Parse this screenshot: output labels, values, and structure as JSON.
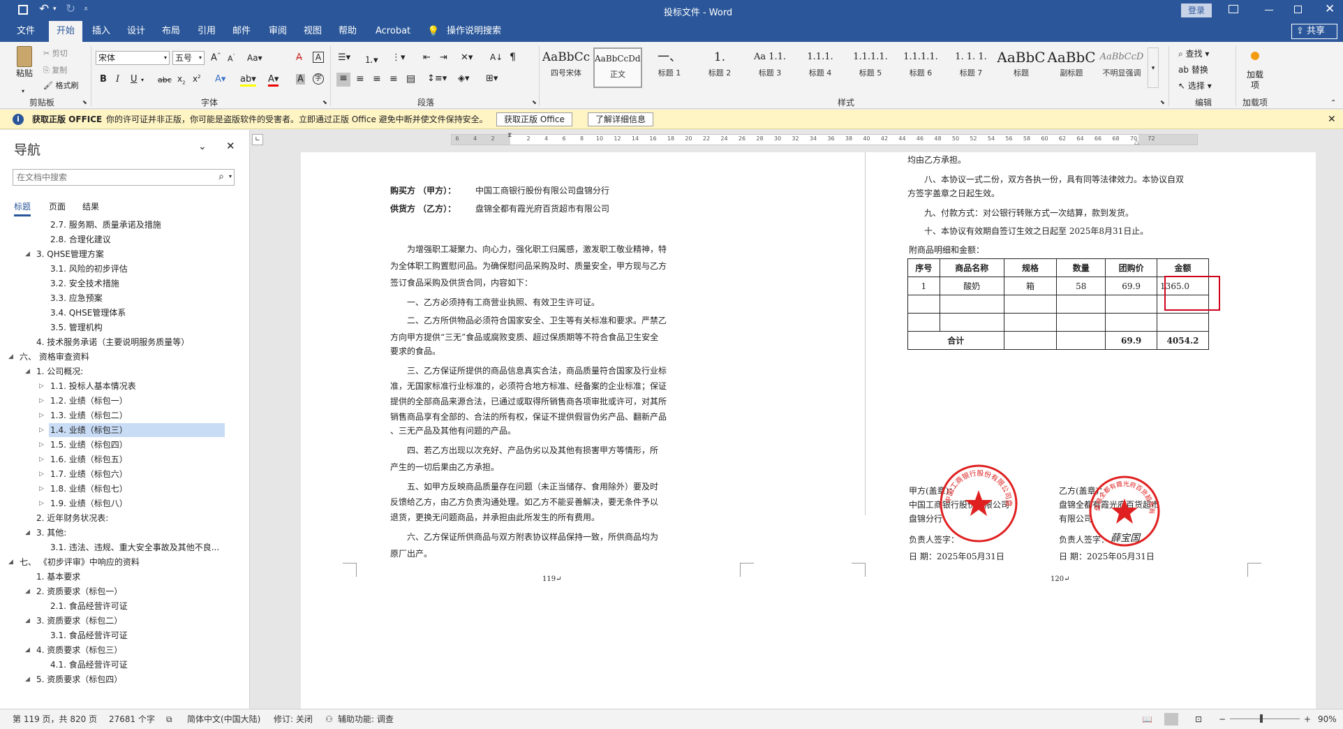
{
  "titlebar": {
    "title": "投标文件  -  Word",
    "login": "登录"
  },
  "menu": {
    "items": [
      "文件",
      "开始",
      "插入",
      "设计",
      "布局",
      "引用",
      "邮件",
      "审阅",
      "视图",
      "帮助",
      "Acrobat",
      "操作说明搜索"
    ],
    "share": "共享"
  },
  "ribbon": {
    "clipboard": {
      "paste": "粘贴",
      "cut": "剪切",
      "copy": "复制",
      "format_painter": "格式刷",
      "label": "剪贴板"
    },
    "font": {
      "font_name": "宋体",
      "font_size": "五号",
      "label": "字体"
    },
    "paragraph": {
      "label": "段落"
    },
    "styles": {
      "label": "样式",
      "items": [
        {
          "sample": "AaBbCc",
          "name": "四号宋体"
        },
        {
          "sample": "AaBbCcDdE",
          "name": "正文"
        },
        {
          "sample": "一、",
          "name": "标题 1"
        },
        {
          "sample": "1.",
          "name": "标题 2"
        },
        {
          "sample": "Aa 1.1.",
          "name": "标题 3"
        },
        {
          "sample": "1.1.1.",
          "name": "标题 4"
        },
        {
          "sample": "1.1.1.1.",
          "name": "标题 5"
        },
        {
          "sample": "1.1.1.1.",
          "name": "标题 6"
        },
        {
          "sample": "1. 1. 1.",
          "name": "标题 7"
        },
        {
          "sample": "AaBbC",
          "name": "标题"
        },
        {
          "sample": "AaBbC",
          "name": "副标题"
        },
        {
          "sample": "AaBbCcD",
          "name": "不明显强调"
        }
      ]
    },
    "editing": {
      "find": "查找",
      "replace": "替换",
      "select": "选择",
      "label": "编辑"
    },
    "addins": {
      "add": "加载项",
      "label": "加载项"
    }
  },
  "infobar": {
    "title": "获取正版 OFFICE",
    "message": "你的许可证并非正版，你可能是盗版软件的受害者。立即通过正版 Office 避免中断并使文件保持安全。",
    "btn_get": "获取正版 Office",
    "btn_learn": "了解详细信息"
  },
  "nav": {
    "title": "导航",
    "search_placeholder": "在文档中搜索",
    "tabs": [
      "标题",
      "页面",
      "结果"
    ],
    "items": [
      {
        "text": "2.7. 服务期、质量承诺及措施",
        "level": 3,
        "arrow": ""
      },
      {
        "text": "2.8. 合理化建议",
        "level": 3,
        "arrow": ""
      },
      {
        "text": "3. QHSE管理方案",
        "level": 2,
        "arrow": "open"
      },
      {
        "text": "3.1. 风险的初步评估",
        "level": 3,
        "arrow": ""
      },
      {
        "text": "3.2. 安全技术措施",
        "level": 3,
        "arrow": ""
      },
      {
        "text": "3.3. 应急预案",
        "level": 3,
        "arrow": ""
      },
      {
        "text": "3.4. QHSE管理体系",
        "level": 3,
        "arrow": ""
      },
      {
        "text": "3.5. 管理机构",
        "level": 3,
        "arrow": ""
      },
      {
        "text": "4. 技术服务承诺（主要说明服务质量等）",
        "level": 2,
        "arrow": ""
      },
      {
        "text": "六、 资格审查资料",
        "level": 1,
        "arrow": "open"
      },
      {
        "text": "1. 公司概况:",
        "level": 2,
        "arrow": "open"
      },
      {
        "text": "1.1. 投标人基本情况表",
        "level": 3,
        "arrow": "closed"
      },
      {
        "text": "1.2. 业绩（标包一）",
        "level": 3,
        "arrow": "closed"
      },
      {
        "text": "1.3. 业绩（标包二）",
        "level": 3,
        "arrow": "closed"
      },
      {
        "text": "1.4. 业绩（标包三）",
        "level": 3,
        "arrow": "closed",
        "selected": true
      },
      {
        "text": "1.5. 业绩（标包四）",
        "level": 3,
        "arrow": "closed"
      },
      {
        "text": "1.6. 业绩（标包五）",
        "level": 3,
        "arrow": "closed"
      },
      {
        "text": "1.7. 业绩（标包六）",
        "level": 3,
        "arrow": "closed"
      },
      {
        "text": "1.8. 业绩（标包七）",
        "level": 3,
        "arrow": "closed"
      },
      {
        "text": "1.9. 业绩（标包八）",
        "level": 3,
        "arrow": "closed"
      },
      {
        "text": "2. 近年财务状况表:",
        "level": 2,
        "arrow": ""
      },
      {
        "text": "3. 其他:",
        "level": 2,
        "arrow": "open"
      },
      {
        "text": "3.1. 违法、违规、重大安全事故及其他不良...",
        "level": 3,
        "arrow": ""
      },
      {
        "text": "七、 《初步评审》中响应的资料",
        "level": 1,
        "arrow": "open"
      },
      {
        "text": "1. 基本要求",
        "level": 2,
        "arrow": ""
      },
      {
        "text": "2. 资质要求（标包一）",
        "level": 2,
        "arrow": "open"
      },
      {
        "text": "2.1. 食品经营许可证",
        "level": 3,
        "arrow": ""
      },
      {
        "text": "3. 资质要求（标包二）",
        "level": 2,
        "arrow": "open"
      },
      {
        "text": "3.1. 食品经营许可证",
        "level": 3,
        "arrow": ""
      },
      {
        "text": "4. 资质要求（标包三）",
        "level": 2,
        "arrow": "open"
      },
      {
        "text": "4.1. 食品经营许可证",
        "level": 3,
        "arrow": ""
      },
      {
        "text": "5. 资质要求（标包四）",
        "level": 2,
        "arrow": "open"
      }
    ]
  },
  "ruler": {
    "ticks": [
      "6",
      "4",
      "2",
      "",
      "2",
      "4",
      "6",
      "8",
      "10",
      "12",
      "14",
      "16",
      "18",
      "20",
      "22",
      "24",
      "26",
      "28",
      "30",
      "32",
      "34",
      "36",
      "38",
      "40",
      "42",
      "44",
      "46",
      "48",
      "50",
      "52",
      "54",
      "56",
      "58",
      "60",
      "62",
      "64",
      "66",
      "68",
      "70",
      "72"
    ]
  },
  "page_left": {
    "buyer": "购买方 （甲方）：",
    "buyer_name": "中国工商银行股份有限公司盘锦分行",
    "seller": "供货方 （乙方）：",
    "seller_name": "盘锦全都有霞光府百货超市有限公司",
    "lines": [
      "　　为增强职工凝聚力、向心力，强化职工归属感，激发职工敬业精神，特",
      "为全体职工购置慰问品。为确保慰问品采购及时、质量安全，甲方现与乙方",
      "签订食品采购及供货合同，内容如下：",
      "　　一、乙方必须持有工商营业执照、有效卫生许可证。",
      "　　二、乙方所供物品必须符合国家安全、卫生等有关标准和要求。严禁乙",
      "方向甲方提供“三无”食品或腐败变质、超过保质期等不符合食品卫生安全",
      "要求的食品。",
      "　　三、乙方保证所提供的商品信息真实合法，商品质量符合国家及行业标",
      "准，无国家标准行业标准的，必须符合地方标准、经备案的企业标准；保证",
      "提供的全部商品来源合法，已通过或取得所销售商各项审批或许可，对其所",
      "销售商品享有全部的、合法的所有权，保证不提供假冒伪劣产品、翻新产品",
      "、三无产品及其他有问题的产品。",
      "　　四、若乙方出现以次充好、产品伪劣以及其他有损害甲方等情形，所",
      "产生的一切后果由乙方承担。",
      "　　五、如甲方反映商品质量存在问题（未正当储存、食用除外）要及时",
      "反馈给乙方，由乙方负责沟通处理。如乙方不能妥善解决，要无条件予以",
      "退货，更换无问题商品，并承担由此所发生的所有费用。",
      "　　六、乙方保证所供商品与双方附表协议样品保持一致，所供商品均为",
      "原厂出产。"
    ],
    "page_no": "119↵"
  },
  "page_right": {
    "lines": [
      "均由乙方承担。",
      "　　八、本协议一式二份，双方各执一份，具有同等法律效力。本协议自双",
      "方签字盖章之日起生效。",
      "　　九、付款方式：对公银行转账方式一次结算，款到发货。",
      "　　十、本协议有效期自签订生效之日起至 2025年8月31日止。"
    ],
    "table_title": "附商品明细和金额：",
    "table": {
      "headers": [
        "序号",
        "商品名称",
        "规格",
        "数量",
        "团购价",
        "金额"
      ],
      "rows": [
        [
          "1",
          "酸奶",
          "箱",
          "58",
          "69.9",
          "1365.0"
        ],
        [
          "",
          "",
          "",
          "",
          "",
          ""
        ],
        [
          "",
          "",
          "",
          "",
          "",
          ""
        ]
      ],
      "total": [
        "合计",
        "",
        "",
        "69.9",
        "4054.2"
      ]
    },
    "party_a": [
      "甲方(盖章)：",
      "中国工商银行股份有限公司",
      "盘锦分行"
    ],
    "party_b": [
      "乙方(盖章)：",
      "盘锦全都有霞光府百货超市",
      "有限公司"
    ],
    "sign_a": "负责人签字：",
    "sign_b": "负责人签字：",
    "signature": "薛宝国",
    "date_a": "日  期：2025年05月31日",
    "date_b": "日  期：2025年05月31日",
    "seal_a_text": "中国工商银行股份有限公司盘锦分行",
    "seal_b_text": "盘锦全都有霞光府百货超市有限公司",
    "page_no": "120↵"
  },
  "statusbar": {
    "page": "第 119 页，共 820 页",
    "words": "27681 个字",
    "lang": "简体中文(中国大陆)",
    "track": "修订: 关闭",
    "accessibility": "辅助功能: 调查",
    "zoom": "90%"
  },
  "colors": {
    "accent": "#2b579a",
    "highlight_box": "#d0021b",
    "seal": "#e02020"
  }
}
